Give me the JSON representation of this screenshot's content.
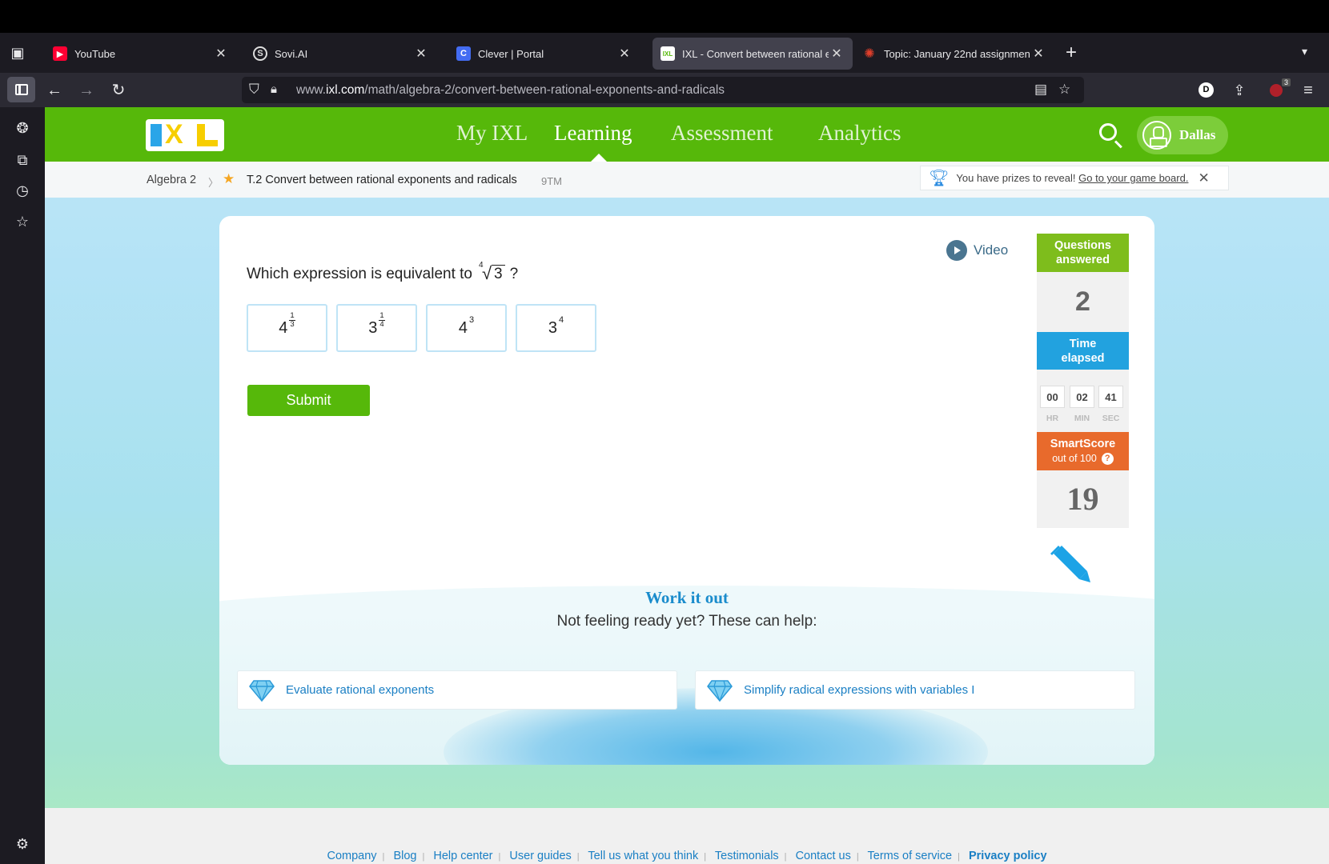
{
  "browser": {
    "tabs": [
      {
        "title": "YouTube",
        "active": false,
        "favicon": "youtube-icon",
        "color": "#ff0033"
      },
      {
        "title": "Sovi.AI",
        "active": false,
        "favicon": "sovi-icon",
        "color": "#333333"
      },
      {
        "title": "Clever | Portal",
        "active": false,
        "favicon": "clever-icon",
        "color": "#436cf2"
      },
      {
        "title": "IXL - Convert between rational e",
        "active": true,
        "favicon": "ixl-icon",
        "color": "#56b80a"
      },
      {
        "title": "Topic: January 22nd assignmen",
        "active": false,
        "favicon": "canvas-icon",
        "color": "#e13f2b"
      }
    ],
    "new_tab": "+",
    "url_prefix": "www.",
    "url_domain": "ixl.com",
    "url_path": "/math/algebra-2/convert-between-rational-exponents-and-radicals",
    "profile_initial": "D",
    "extension_badge": "3"
  },
  "ixl": {
    "nav": {
      "my_ixl": "My IXL",
      "learning": "Learning",
      "assessment": "Assessment",
      "analytics": "Analytics"
    },
    "user_name": "Dallas",
    "breadcrumb": {
      "subject": "Algebra 2",
      "skill": "T.2 Convert between rational exponents and radicals",
      "code": "9TM"
    },
    "prize": {
      "text": "You have prizes to reveal! ",
      "link": "Go to your game board."
    },
    "question": {
      "prefix": "Which expression is equivalent to",
      "radical_index": "4",
      "radicand": "3",
      "suffix": "?"
    },
    "choices": [
      {
        "base": "4",
        "num": "1",
        "den": "3"
      },
      {
        "base": "3",
        "num": "1",
        "den": "4"
      },
      {
        "base": "4",
        "exp": "3"
      },
      {
        "base": "3",
        "exp": "4"
      }
    ],
    "submit_label": "Submit",
    "video_label": "Video",
    "stats": {
      "questions_answered_label": "Questions answered",
      "questions_answered": "2",
      "time_elapsed_label": "Time elapsed",
      "time": {
        "hr": "00",
        "min": "02",
        "sec": "41"
      },
      "time_units": {
        "hr": "HR",
        "min": "MIN",
        "sec": "SEC"
      },
      "smartscore_label": "SmartScore",
      "smartscore_sub": "out of 100",
      "smartscore_help": "?",
      "smartscore": "19"
    },
    "work_it_out": "Work it out",
    "not_ready": "Not feeling ready yet? These can help:",
    "help_skills": [
      "Evaluate rational exponents",
      "Simplify radical expressions with variables I"
    ],
    "footer_links": [
      "Company",
      "Blog",
      "Help center",
      "User guides",
      "Tell us what you think",
      "Testimonials",
      "Contact us",
      "Terms of service"
    ],
    "footer_bold_link": "Privacy policy"
  },
  "colors": {
    "ixl_green": "#56b80a",
    "time_blue": "#22a2df",
    "smartscore_orange": "#e86a2c",
    "link_blue": "#1a7fc4"
  }
}
